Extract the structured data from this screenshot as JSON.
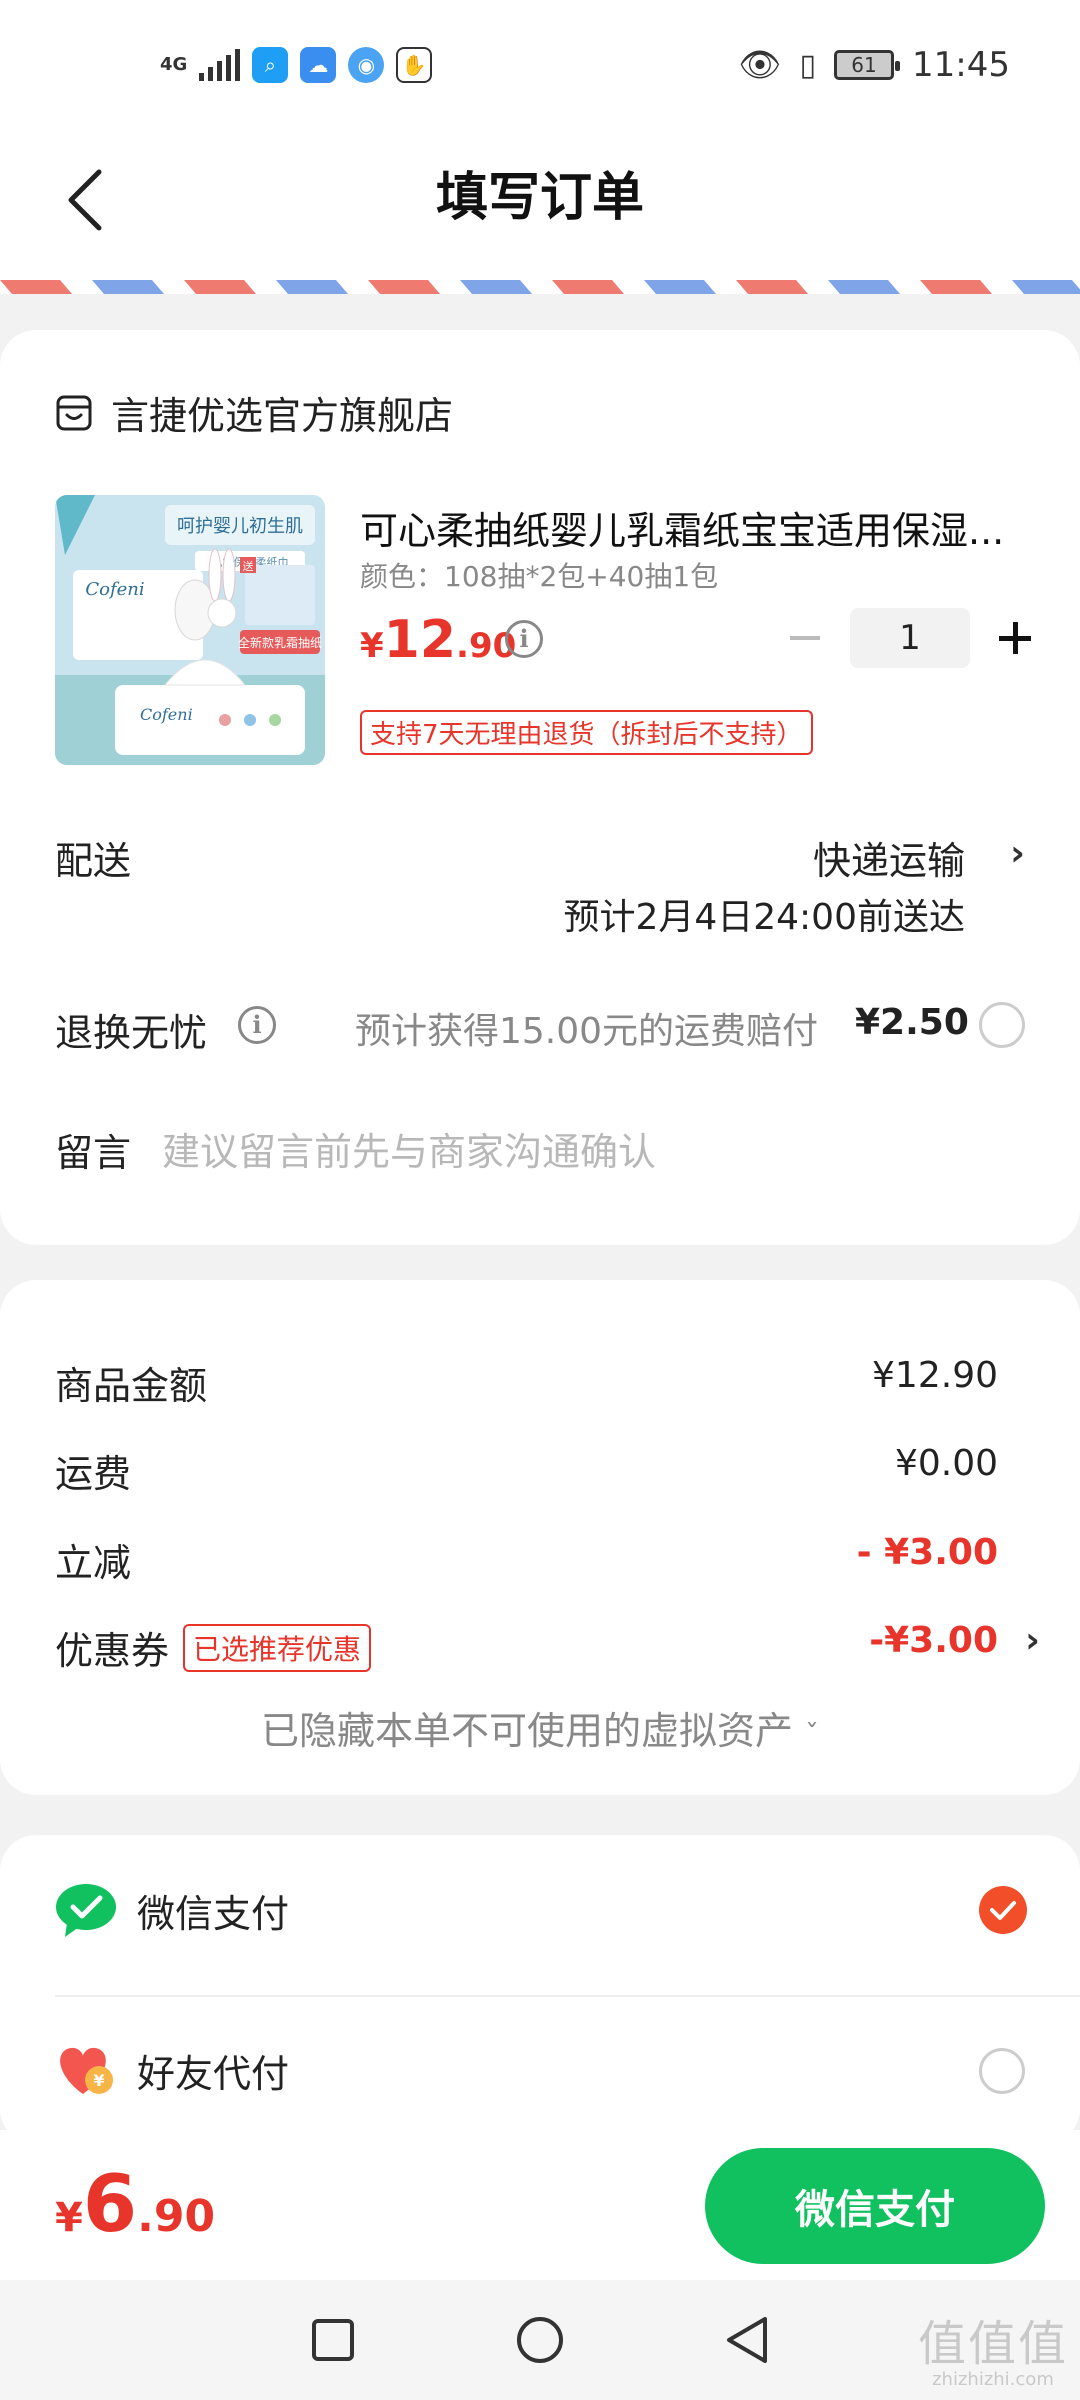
{
  "status_bar": {
    "network": "4G",
    "battery": "61",
    "time": "11:45"
  },
  "header": {
    "title": "填写订单",
    "back_icon": "chevron-left-icon"
  },
  "order": {
    "shop_name": "言捷优选官方旗舰店",
    "product": {
      "title": "可心柔抽纸婴儿乳霜纸宝宝适用保湿...",
      "spec": "颜色：108抽*2包+40抽1包",
      "price_currency": "¥",
      "price_int": "12",
      "price_dec": ".90",
      "quantity": "1",
      "return_policy": "支持7天无理由退货（拆封后不支持）",
      "image_texts": {
        "headline": "呵护婴儿初生肌",
        "sub": "乳霜保湿柔纸巾",
        "brand": "Cofeni",
        "promo": "全新款乳霜抽纸",
        "gift": "送"
      }
    },
    "delivery": {
      "label": "配送",
      "method": "快递运输",
      "eta": "预计2月4日24:00前送达"
    },
    "worry_free": {
      "label": "退换无忧",
      "desc": "预计获得15.00元的运费赔付",
      "price": "¥2.50"
    },
    "message": {
      "label": "留言",
      "placeholder": "建议留言前先与商家沟通确认"
    }
  },
  "fees": {
    "goods_label": "商品金额",
    "goods_value": "¥12.90",
    "shipping_label": "运费",
    "shipping_value": "¥0.00",
    "discount_label": "立减",
    "discount_value": "- ¥3.00",
    "coupon_label": "优惠券",
    "coupon_badge": "已选推荐优惠",
    "coupon_value": "-¥3.00",
    "hidden_assets": "已隐藏本单不可使用的虚拟资产"
  },
  "payment": {
    "wechat_label": "微信支付",
    "friend_label": "好友代付",
    "friend_icon_text": "¥"
  },
  "bottom": {
    "currency": "¥",
    "total_int": "6",
    "total_dec": ".90",
    "pay_button": "微信支付"
  },
  "watermark": {
    "big": "值值值",
    "small": "zhizhizhi.com"
  },
  "colors": {
    "accent_red": "#e8352b",
    "wechat_green": "#11c15f",
    "checked_orange": "#f24e2a"
  }
}
